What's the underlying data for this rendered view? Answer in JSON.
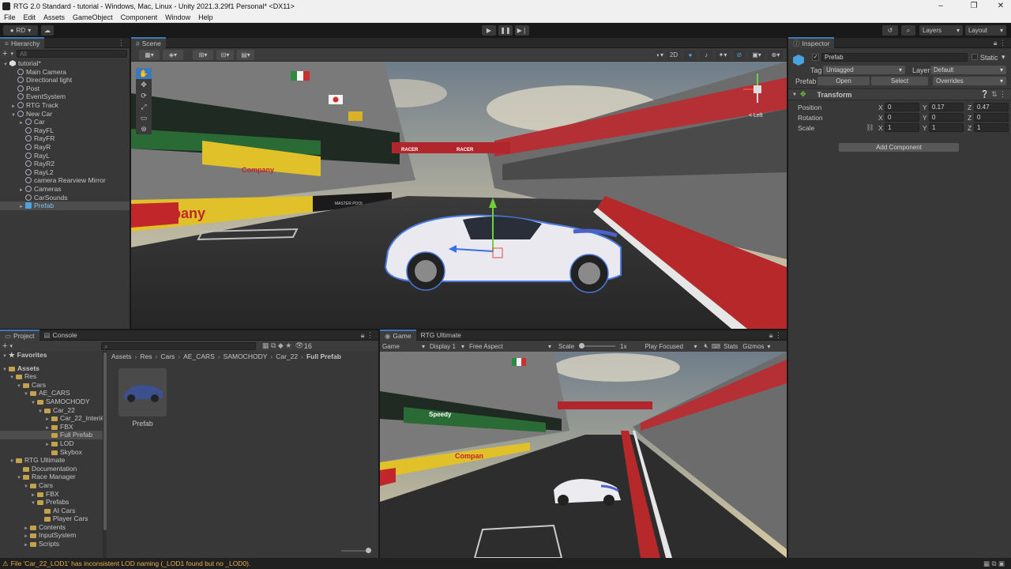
{
  "window": {
    "title": "RTG 2.0 Standard - tutorial - Windows, Mac, Linux - Unity 2021.3.29f1 Personal* <DX11>"
  },
  "menu": [
    "File",
    "Edit",
    "Assets",
    "GameObject",
    "Component",
    "Window",
    "Help"
  ],
  "toolbar": {
    "account": "RD",
    "layers": "Layers",
    "layout": "Layout"
  },
  "hierarchy": {
    "tab": "Hierarchy",
    "search_placeholder": "All",
    "items": [
      {
        "label": "tutorial*",
        "depth": 0,
        "icon": "unity",
        "tri": "▼",
        "sel": ""
      },
      {
        "label": "Main Camera",
        "depth": 1,
        "icon": "go",
        "tri": "",
        "sel": ""
      },
      {
        "label": "Directional light",
        "depth": 1,
        "icon": "go",
        "tri": "",
        "sel": ""
      },
      {
        "label": "Post",
        "depth": 1,
        "icon": "go",
        "tri": "",
        "sel": ""
      },
      {
        "label": "EventSystem",
        "depth": 1,
        "icon": "go",
        "tri": "",
        "sel": ""
      },
      {
        "label": "RTG Track",
        "depth": 1,
        "icon": "go",
        "tri": "►",
        "sel": ""
      },
      {
        "label": "New Car",
        "depth": 1,
        "icon": "go",
        "tri": "▼",
        "sel": ""
      },
      {
        "label": "Car",
        "depth": 2,
        "icon": "go",
        "tri": "►",
        "sel": ""
      },
      {
        "label": "RayFL",
        "depth": 2,
        "icon": "go",
        "tri": "",
        "sel": ""
      },
      {
        "label": "RayFR",
        "depth": 2,
        "icon": "go",
        "tri": "",
        "sel": ""
      },
      {
        "label": "RayR",
        "depth": 2,
        "icon": "go",
        "tri": "",
        "sel": ""
      },
      {
        "label": "RayL",
        "depth": 2,
        "icon": "go",
        "tri": "",
        "sel": ""
      },
      {
        "label": "RayR2",
        "depth": 2,
        "icon": "go",
        "tri": "",
        "sel": ""
      },
      {
        "label": "RayL2",
        "depth": 2,
        "icon": "go",
        "tri": "",
        "sel": ""
      },
      {
        "label": "camera Rearview Mirror",
        "depth": 2,
        "icon": "go",
        "tri": "",
        "sel": ""
      },
      {
        "label": "Cameras",
        "depth": 2,
        "icon": "go",
        "tri": "►",
        "sel": ""
      },
      {
        "label": "CarSounds",
        "depth": 2,
        "icon": "go",
        "tri": "",
        "sel": ""
      },
      {
        "label": "Prefab",
        "depth": 2,
        "icon": "prefab",
        "tri": "►",
        "sel": "sel2"
      }
    ]
  },
  "scene": {
    "tab": "Scene",
    "mode_2d": "2D",
    "gizmo_label": "< Left"
  },
  "inspector": {
    "tab": "Inspector",
    "object_name": "Prefab",
    "static_label": "Static",
    "tag_label": "Tag",
    "tag_value": "Untagged",
    "layer_label": "Layer",
    "layer_value": "Default",
    "prefab_label": "Prefab",
    "open": "Open",
    "select": "Select",
    "overrides": "Overrides",
    "transform": "Transform",
    "position": {
      "label": "Position",
      "x": "0",
      "y": "0.17",
      "z": "0.47"
    },
    "rotation": {
      "label": "Rotation",
      "x": "0",
      "y": "0",
      "z": "0"
    },
    "scale": {
      "label": "Scale",
      "x": "1",
      "y": "1",
      "z": "1"
    },
    "add_component": "Add Component"
  },
  "project": {
    "tab": "Project",
    "console_tab": "Console",
    "favorites": "Favorites",
    "count": "16",
    "breadcrumb": [
      "Assets",
      "Res",
      "Cars",
      "AE_CARS",
      "SAMOCHODY",
      "Car_22",
      "Full Prefab"
    ],
    "tree": [
      {
        "label": "Assets",
        "depth": 0,
        "tri": "▼",
        "bold": true,
        "sel": ""
      },
      {
        "label": "Res",
        "depth": 1,
        "tri": "▼",
        "sel": ""
      },
      {
        "label": "Cars",
        "depth": 2,
        "tri": "▼",
        "sel": ""
      },
      {
        "label": "AE_CARS",
        "depth": 3,
        "tri": "▼",
        "sel": ""
      },
      {
        "label": "SAMOCHODY",
        "depth": 4,
        "tri": "▼",
        "sel": ""
      },
      {
        "label": "Car_22",
        "depth": 5,
        "tri": "▼",
        "sel": ""
      },
      {
        "label": "Car_22_Interiê",
        "depth": 6,
        "tri": "►",
        "sel": ""
      },
      {
        "label": "FBX",
        "depth": 6,
        "tri": "►",
        "sel": ""
      },
      {
        "label": "Full Prefab",
        "depth": 6,
        "tri": "",
        "sel": "sel2"
      },
      {
        "label": "LOD",
        "depth": 6,
        "tri": "►",
        "sel": ""
      },
      {
        "label": "Skybox",
        "depth": 6,
        "tri": "",
        "sel": ""
      },
      {
        "label": "RTG Ultimate",
        "depth": 1,
        "tri": "▼",
        "sel": ""
      },
      {
        "label": "Documentation",
        "depth": 2,
        "tri": "",
        "sel": ""
      },
      {
        "label": "Race Manager",
        "depth": 2,
        "tri": "▼",
        "sel": ""
      },
      {
        "label": "Cars",
        "depth": 3,
        "tri": "▼",
        "sel": ""
      },
      {
        "label": "FBX",
        "depth": 4,
        "tri": "►",
        "sel": ""
      },
      {
        "label": "Prefabs",
        "depth": 4,
        "tri": "▼",
        "sel": ""
      },
      {
        "label": "AI Cars",
        "depth": 5,
        "tri": "",
        "sel": ""
      },
      {
        "label": "Player Cars",
        "depth": 5,
        "tri": "",
        "sel": ""
      },
      {
        "label": "Contents",
        "depth": 3,
        "tri": "►",
        "sel": ""
      },
      {
        "label": "InputSystem",
        "depth": 3,
        "tri": "►",
        "sel": ""
      },
      {
        "label": "Scripts",
        "depth": 3,
        "tri": "►",
        "sel": ""
      }
    ],
    "asset_label": "Prefab"
  },
  "game": {
    "tab": "Game",
    "tab2": "RTG Ultimate",
    "mode": "Game",
    "display": "Display 1",
    "aspect": "Free Aspect",
    "scale_label": "Scale",
    "scale_value": "1x",
    "play_focused": "Play Focused",
    "stats": "Stats",
    "gizmos": "Gizmos"
  },
  "status": {
    "message": "File 'Car_22_LOD1' has inconsistent LOD naming (_LOD1 found but no _LOD0)."
  },
  "scene_text": {
    "company": "ompany",
    "racer1": "RACER",
    "racer2": "RACER",
    "company2": "Company",
    "game_company": "Compan",
    "speedy": "Speedy",
    "master": "MASTER POOL"
  }
}
